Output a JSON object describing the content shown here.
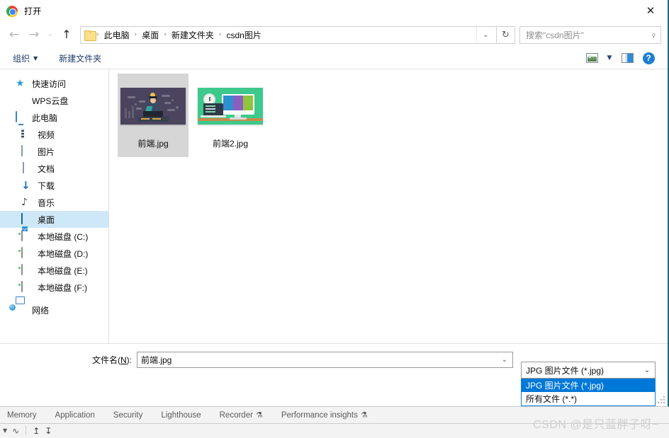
{
  "window": {
    "title": "打开",
    "app_icon": "chrome-icon",
    "close_label": "✕"
  },
  "nav": {
    "back_icon": "←",
    "forward_icon": "→",
    "recent_icon": "⌄",
    "up_icon": "↑",
    "refresh_icon": "↻",
    "dropdown_icon": "⌄"
  },
  "breadcrumb": {
    "separator": "›",
    "items": [
      "此电脑",
      "桌面",
      "新建文件夹",
      "csdn图片"
    ]
  },
  "search": {
    "placeholder": "搜索\"csdn图片\"",
    "icon": "⌕"
  },
  "commandbar": {
    "organize_label": "组织",
    "organize_caret": "▼",
    "new_folder_label": "新建文件夹",
    "view_icon": "view-mode-icon",
    "view_caret": "▼",
    "preview_pane_icon": "preview-pane-icon",
    "help_label": "?"
  },
  "sidebar": {
    "items": [
      {
        "label": "快速访问",
        "icon": "star-icon",
        "level": 0,
        "selected": false
      },
      {
        "label": "WPS云盘",
        "icon": "cloud-icon",
        "level": 0,
        "selected": false
      },
      {
        "label": "此电脑",
        "icon": "computer-icon",
        "level": 0,
        "selected": false
      },
      {
        "label": "视频",
        "icon": "video-icon",
        "level": 1,
        "selected": false
      },
      {
        "label": "图片",
        "icon": "pictures-icon",
        "level": 1,
        "selected": false
      },
      {
        "label": "文档",
        "icon": "documents-icon",
        "level": 1,
        "selected": false
      },
      {
        "label": "下载",
        "icon": "downloads-icon",
        "level": 1,
        "selected": false
      },
      {
        "label": "音乐",
        "icon": "music-icon",
        "level": 1,
        "selected": false
      },
      {
        "label": "桌面",
        "icon": "desktop-icon",
        "level": 1,
        "selected": true
      },
      {
        "label": "本地磁盘 (C:)",
        "icon": "drive-windows-icon",
        "level": 1,
        "selected": false
      },
      {
        "label": "本地磁盘 (D:)",
        "icon": "drive-icon",
        "level": 1,
        "selected": false
      },
      {
        "label": "本地磁盘 (E:)",
        "icon": "drive-icon",
        "level": 1,
        "selected": false
      },
      {
        "label": "本地磁盘 (F:)",
        "icon": "drive-icon",
        "level": 1,
        "selected": false
      },
      {
        "label": "网络",
        "icon": "network-icon",
        "level": 0,
        "selected": false
      }
    ]
  },
  "files": [
    {
      "name": "前端.jpg",
      "selected": true,
      "thumbnail": "developer-illustration"
    },
    {
      "name": "前端2.jpg",
      "selected": false,
      "thumbnail": "monitor-illustration"
    }
  ],
  "footer": {
    "filename_label_pre": "文件名(",
    "filename_accel": "N",
    "filename_label_post": "):",
    "filename_value": "前端.jpg",
    "filename_caret": "⌄",
    "filetype_value": "JPG 图片文件 (*.jpg)",
    "filetype_caret": "⌄",
    "filetype_options": [
      {
        "label": "JPG 图片文件 (*.jpg)",
        "highlighted": true
      },
      {
        "label": "所有文件 (*.*)",
        "highlighted": false
      }
    ]
  },
  "devtools": {
    "tabs": [
      {
        "label": "Memory",
        "flask": false
      },
      {
        "label": "Application",
        "flask": false
      },
      {
        "label": "Security",
        "flask": false
      },
      {
        "label": "Lighthouse",
        "flask": false
      },
      {
        "label": "Recorder",
        "flask": true
      },
      {
        "label": "Performance insights",
        "flask": true
      }
    ],
    "flask_glyph": "⚗",
    "caret_glyph": "▼",
    "wifi_icon": "throttling-icon",
    "upload_glyph": "↥",
    "download_glyph": "↧"
  },
  "watermark": "CSDN @是只蓝胖子呀~",
  "colors": {
    "selection_blue": "#0078d7",
    "sidebar_selected": "#cfe8f7",
    "file_selected": "#d6d6d6",
    "accent_border": "#1a6b7d"
  }
}
